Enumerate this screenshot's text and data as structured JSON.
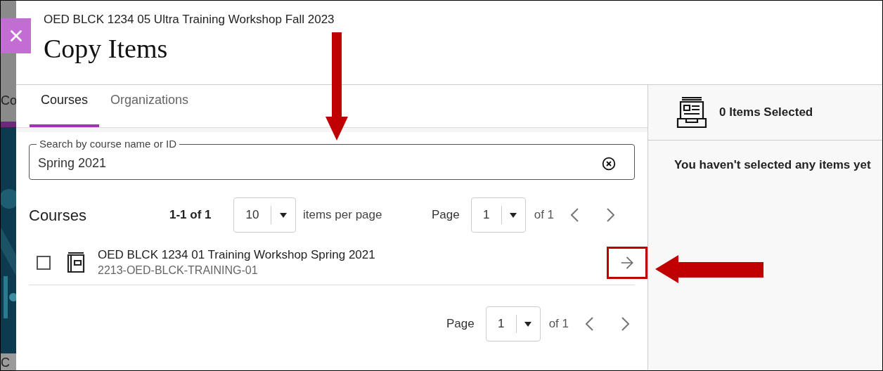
{
  "background": {
    "fragments": [
      "Co",
      "C"
    ]
  },
  "header": {
    "course": "OED BLCK 1234 05 Ultra Training Workshop Fall 2023",
    "title": "Copy Items"
  },
  "tabs": [
    {
      "label": "Courses",
      "selected": true
    },
    {
      "label": "Organizations",
      "selected": false
    }
  ],
  "search": {
    "label": "Search by course name or ID",
    "value": "Spring 2021"
  },
  "results": {
    "heading": "Courses",
    "range": "1-1 of 1",
    "per_page": {
      "value": "10",
      "label": "items per page"
    },
    "pager": {
      "label": "Page",
      "value": "1",
      "total": "of 1"
    }
  },
  "courses": [
    {
      "title": "OED BLCK 1234 01 Training Workshop Spring 2021",
      "id": "2213-OED-BLCK-TRAINING-01",
      "checked": false,
      "highlighted": true
    }
  ],
  "bottom_pager": {
    "label": "Page",
    "value": "1",
    "total": "of 1"
  },
  "selection": {
    "count": "0 Items Selected",
    "empty": "You haven't selected any items yet"
  },
  "annotations": {
    "search_arrow": true,
    "open_button_arrow": true
  }
}
